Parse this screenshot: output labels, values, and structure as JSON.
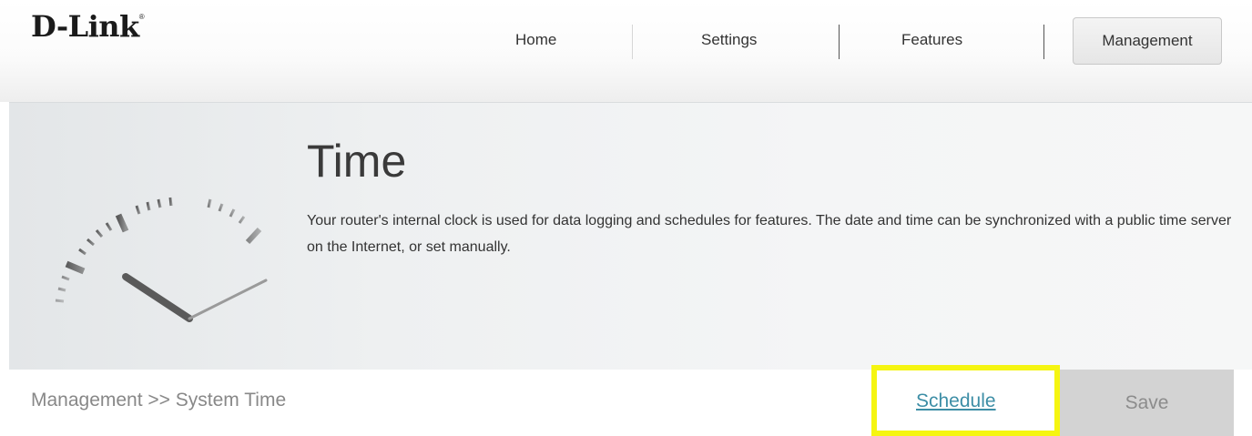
{
  "brand": {
    "logo": "D-Link",
    "logo_tm": "®"
  },
  "nav": {
    "items": [
      {
        "label": "Home"
      },
      {
        "label": "Settings"
      },
      {
        "label": "Features"
      },
      {
        "label": "Management"
      }
    ],
    "active": "Management"
  },
  "banner": {
    "icon": "clock-icon",
    "title": "Time",
    "description": "Your router's internal clock is used for data logging and schedules for features. The date and time can be synchronized with a public time server on the Internet, or set manually."
  },
  "footer": {
    "breadcrumb": "Management >> System Time",
    "schedule_label": "Schedule",
    "save_label": "Save"
  },
  "colors": {
    "link": "#3d8ea6",
    "highlight": "#f5f511",
    "save_bg": "#d3d3d3"
  }
}
